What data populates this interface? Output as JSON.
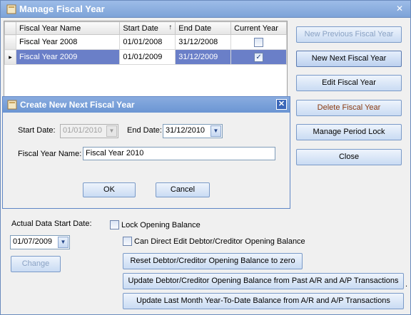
{
  "window": {
    "title": "Manage Fiscal Year",
    "close": "✕"
  },
  "grid": {
    "columns": [
      "Fiscal Year Name",
      "Start Date",
      "End Date",
      "Current Year"
    ],
    "sort_indicator": "↑",
    "row_pointer": "▸",
    "rows": [
      {
        "name": "Fiscal Year 2008",
        "start": "01/01/2008",
        "end": "31/12/2008",
        "current": ""
      },
      {
        "name": "Fiscal Year 2009",
        "start": "01/01/2009",
        "end": "31/12/2009",
        "current": "✓"
      }
    ]
  },
  "buttons": {
    "new_previous": "New Previous Fiscal Year",
    "new_next": "New Next Fiscal Year",
    "edit": "Edit Fiscal Year",
    "delete": "Delete Fiscal Year",
    "manage_period_lock": "Manage Period Lock",
    "close": "Close"
  },
  "dialog": {
    "title": "Create New Next Fiscal Year",
    "close": "✕",
    "start_date_label": "Start Date:",
    "start_date_value": "01/01/2010",
    "end_date_label": "End Date:",
    "end_date_value": "31/12/2010",
    "name_label": "Fiscal Year Name:",
    "name_value": "Fiscal Year 2010",
    "ok": "OK",
    "cancel": "Cancel"
  },
  "bottom": {
    "actual_start_label": "Actual Data Start Date:",
    "actual_start_value": "01/07/2009",
    "change": "Change",
    "lock_opening": "Lock Opening Balance",
    "can_direct_edit": "Can Direct Edit Debtor/Creditor Opening Balance",
    "reset": "Reset Debtor/Creditor Opening Balance to zero",
    "update_past": "Update Debtor/Creditor Opening Balance from Past A/R and A/P Transactions",
    "update_last_month": "Update Last Month Year-To-Date Balance from A/R and A/P Transactions",
    "trailing_dot": "."
  },
  "dropdown_glyph": "▼"
}
